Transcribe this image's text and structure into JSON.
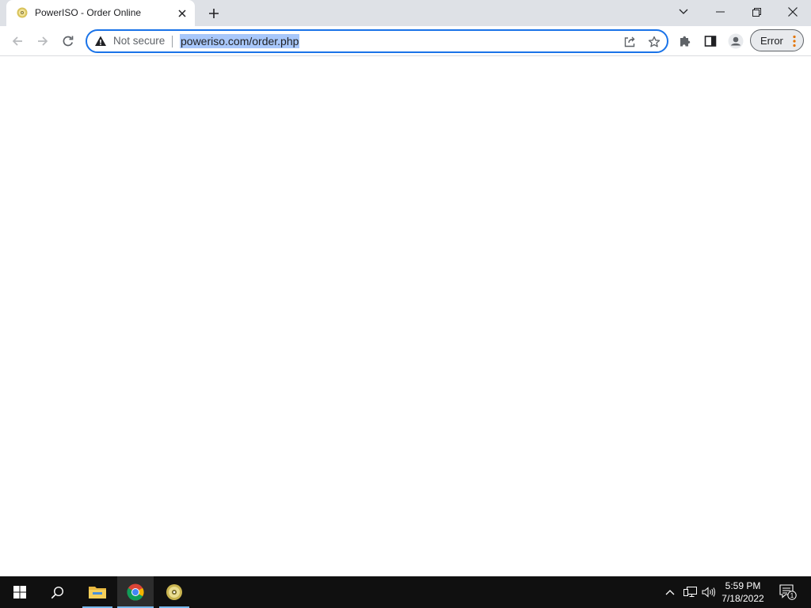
{
  "browser": {
    "tab": {
      "title": "PowerISO - Order Online"
    },
    "omnibox": {
      "security_label": "Not secure",
      "url": "poweriso.com/order.php"
    },
    "profile_error_label": "Error"
  },
  "taskbar": {
    "clock": {
      "time": "5:59 PM",
      "date": "7/18/2022"
    },
    "notification_count": "1"
  },
  "icons": {
    "tab_favicon": "poweriso-disc-icon",
    "warning": "warning-triangle-icon",
    "accent": "#1a73e8"
  }
}
